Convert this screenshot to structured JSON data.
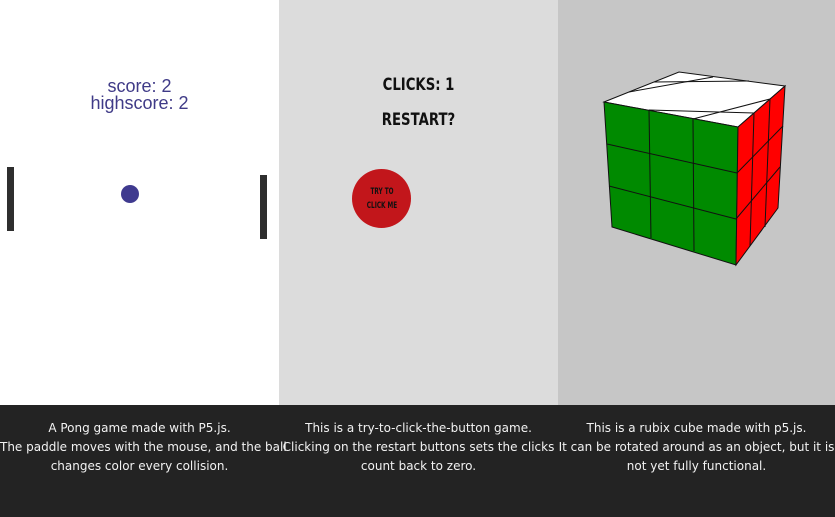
{
  "pong": {
    "score_text": "score: 2",
    "highscore_text": "highscore: 2",
    "ball_color": "#3f3a8f",
    "paddle_color": "#2e2e2e"
  },
  "clicker": {
    "clicks_text": "CLICKS: 1",
    "restart_label": "RESTART?",
    "button_line1": "TRY TO",
    "button_line2": "CLICK ME",
    "button_color": "#c2161b"
  },
  "cube": {
    "top_face_color": "#ffffff",
    "front_face_color": "#008a00",
    "right_face_color": "#ff0000"
  },
  "footer": {
    "pong_desc": [
      "A Pong game made with P5.js.",
      "The paddle moves with the mouse, and the ball",
      "changes color every collision."
    ],
    "clicker_desc": [
      "This is a try-to-click-the-button game.",
      "Clicking on the restart buttons sets the clicks",
      "count back to zero."
    ],
    "cube_desc": [
      "This is a rubix cube made with p5.js.",
      "It can be rotated around as an object, but it is",
      "not yet fully functional."
    ]
  }
}
